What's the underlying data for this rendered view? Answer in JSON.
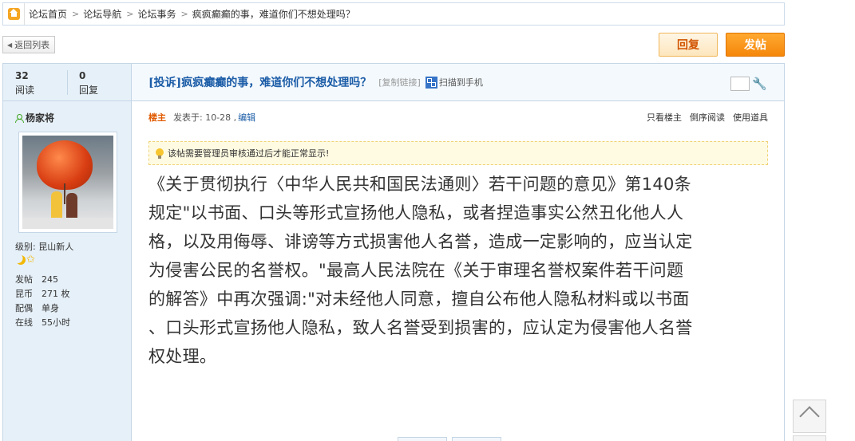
{
  "breadcrumb": {
    "items": [
      "论坛首页",
      "论坛导航",
      "论坛事务",
      "疯疯癫癫的事，难道你们不想处理吗？"
    ]
  },
  "toolbar": {
    "back_label": "返回列表",
    "reply_label": "回复",
    "post_label": "发帖"
  },
  "stats": {
    "views": "32",
    "views_label": "阅读",
    "replies": "0",
    "replies_label": "回复"
  },
  "thread": {
    "title": "[投诉]疯疯癫癫的事，难道你们不想处理吗？",
    "copy_link": "[复制链接]",
    "scan_label": "扫描到手机"
  },
  "author": {
    "name": "杨家将",
    "level": "级别: 昆山新人",
    "info": [
      {
        "k": "发帖",
        "v": "245"
      },
      {
        "k": "昆币",
        "v": "271 枚"
      },
      {
        "k": "配偶",
        "v": "单身"
      },
      {
        "k": "在线",
        "v": "55小时"
      }
    ]
  },
  "post_meta": {
    "op_label": "楼主",
    "posted": "发表于: 10-28 ,",
    "edit": "编辑",
    "only_author": "只看楼主",
    "reverse": "倒序阅读",
    "use_tools": "使用道具"
  },
  "notice": "该帖需要管理员审核通过后才能正常显示!",
  "content": {
    "lines": [
      "《关于贯彻执行〈中华人民共和国民法通则〉若干问题的意见》第140条",
      "规定\"以书面、口头等形式宣扬他人隐私，或者捏造事实公然丑化他人人",
      "格，以及用侮辱、诽谤等方式损害他人名誉，造成一定影响的，应当认定",
      "为侵害公民的名誉权。\"最高人民法院在《关于审理名誉权案件若干问题",
      "的解答》中再次强调:\"对未经他人同意，擅自公布他人隐私材料或以书面",
      "、口头形式宣扬他人隐私，致人名誉受到损害的，应认定为侵害他人名誉",
      "权处理。"
    ]
  },
  "colors": {
    "accent": "#f5870a",
    "title_link": "#1b5ca7",
    "sidebar_bg": "#e6f0f8",
    "border": "#c5d6e6"
  }
}
